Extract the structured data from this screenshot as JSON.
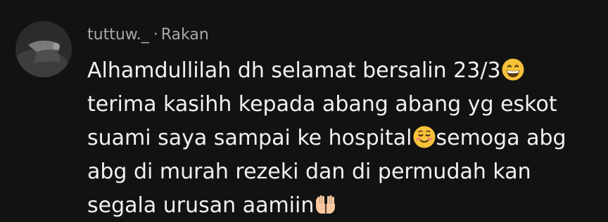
{
  "comment": {
    "username": "tuttuw._",
    "separator": "·",
    "relation": "Rakan",
    "lines": [
      "Alhamdullilah dh selamat bersalin 23/3",
      "terima kasihh kepada abang abang yg eskot",
      "suami saya sampai ke hospital",
      "semoga abg",
      "abg di murah rezeki dan di permudah kan",
      "segala urusan aamiin"
    ],
    "emojis": {
      "grin": "grinning-face-emoji",
      "blush": "smiling-face-emoji",
      "hands": "palms-up-together-emoji"
    }
  },
  "colors": {
    "background": "#121212",
    "text_primary": "#f1f1f1",
    "text_secondary": "#a9a9a9",
    "emoji_yellow": "#f7c23a"
  }
}
